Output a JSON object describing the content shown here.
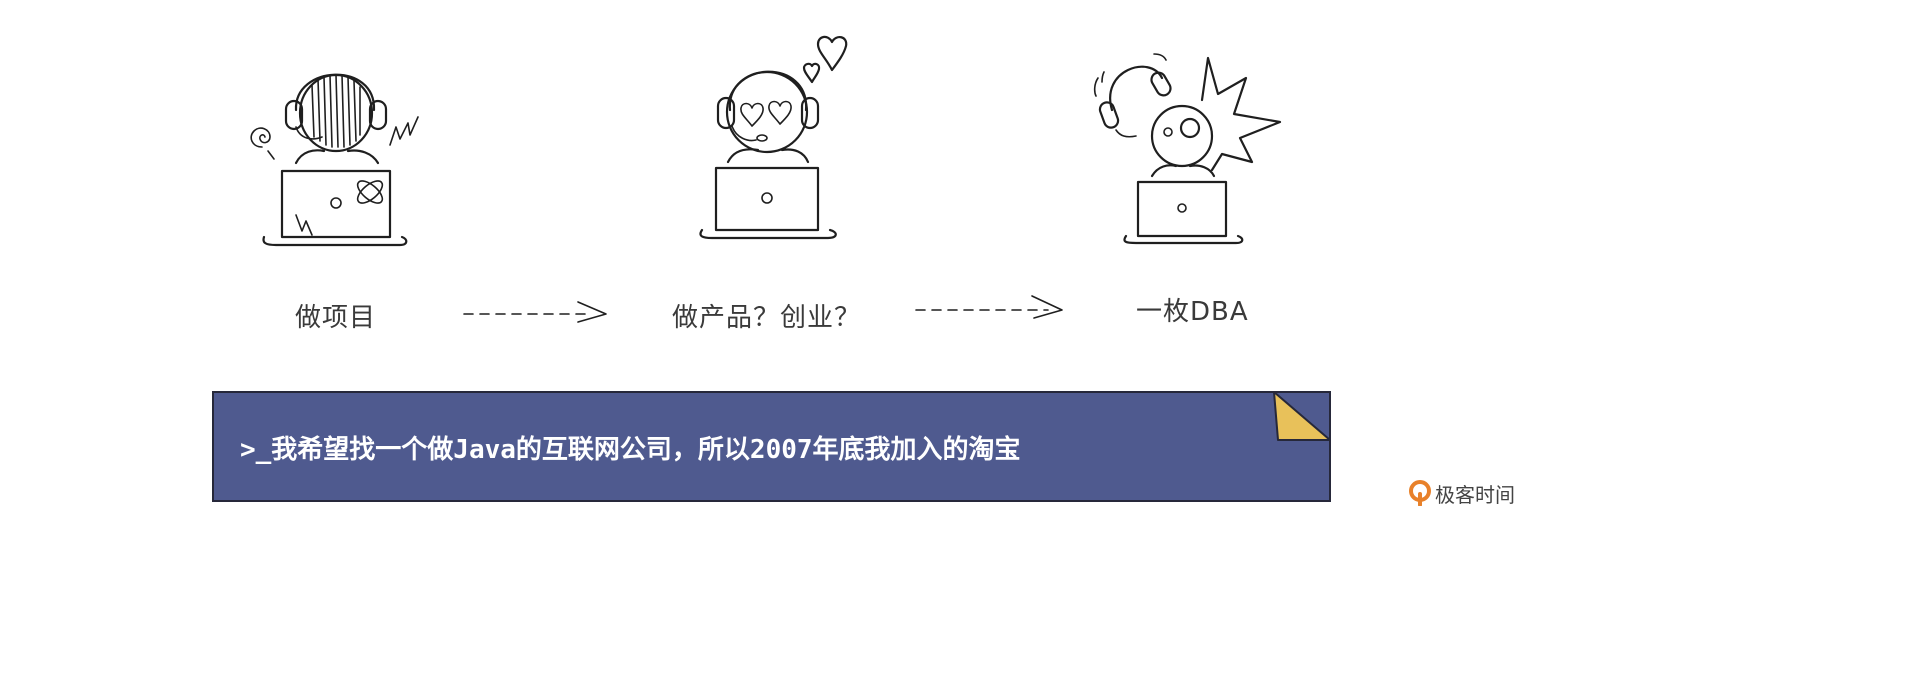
{
  "stages": [
    {
      "label": "做项目",
      "icon": "stressed-developer-icon"
    },
    {
      "label": "做产品？创业？",
      "icon": "heart-eyes-developer-icon"
    },
    {
      "label": "一枚DBA",
      "icon": "exploding-dba-icon"
    }
  ],
  "banner": {
    "text": ">_我希望找一个做Java的互联网公司，所以2007年底我加入的淘宝",
    "color": "#4f5a8f",
    "corner_color": "#e8c15a"
  },
  "logo": {
    "text": "极客时间",
    "accent": "#e8812a"
  }
}
